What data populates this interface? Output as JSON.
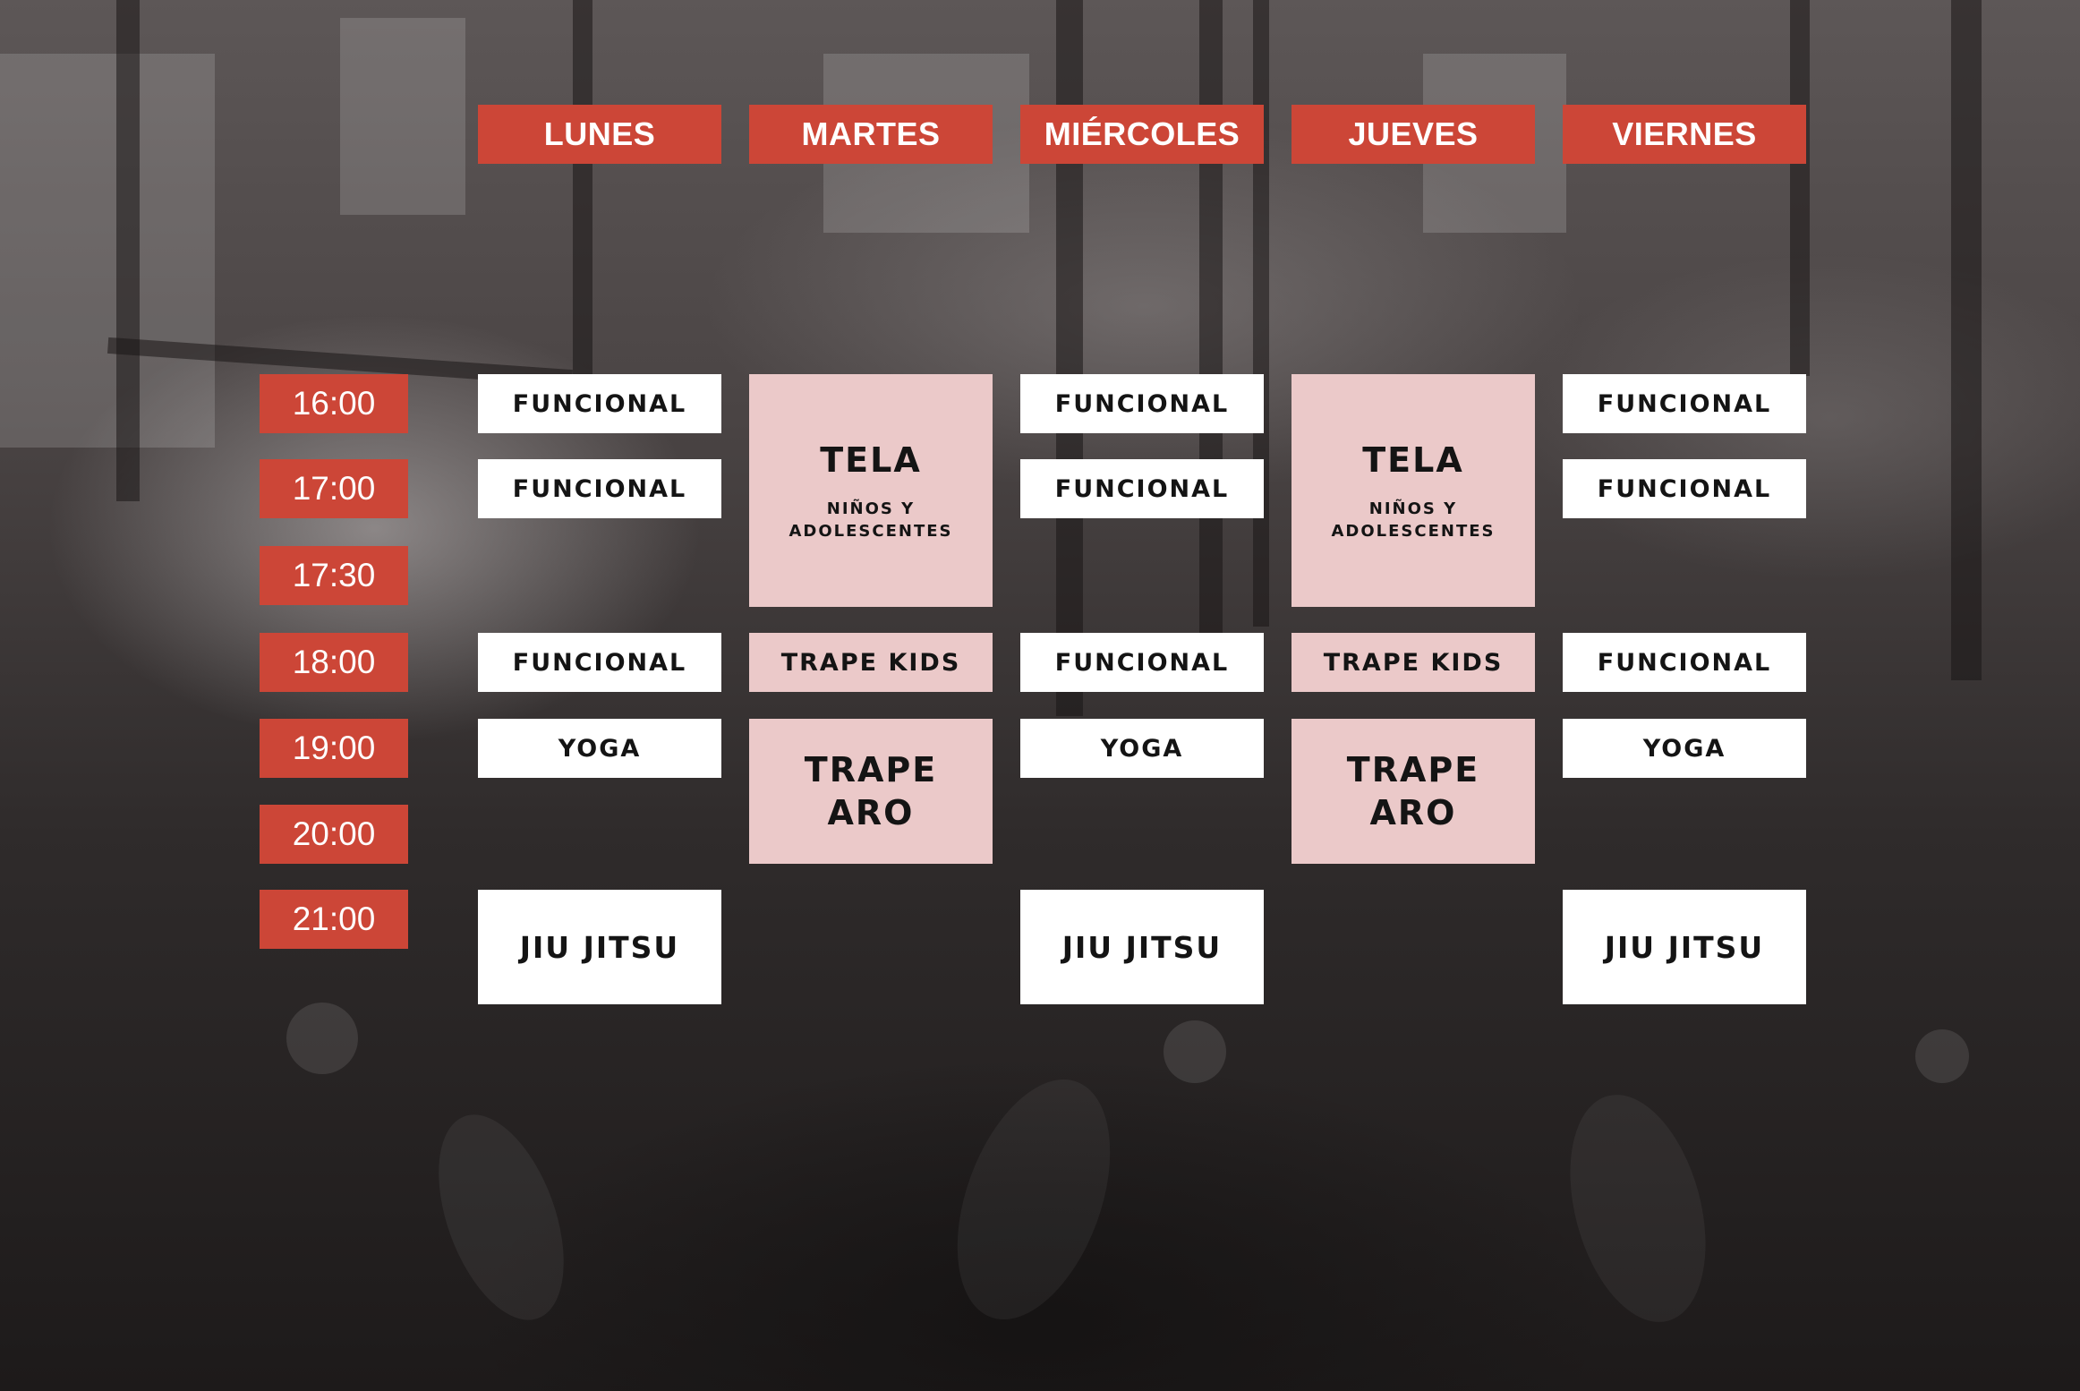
{
  "days": [
    "LUNES",
    "MARTES",
    "MIÉRCOLES",
    "JUEVES",
    "VIERNES"
  ],
  "times": [
    "16:00",
    "17:00",
    "17:30",
    "18:00",
    "19:00",
    "20:00",
    "21:00"
  ],
  "classes": {
    "funcional": "FUNCIONAL",
    "yoga": "YOGA",
    "jiu_jitsu": "JIU JITSU",
    "tela": "TELA",
    "tela_sub_line1": "NIÑOS Y",
    "tela_sub_line2": "ADOLESCENTES",
    "trape_kids": "TRAPE KIDS",
    "trape_aro_line1": "TRAPE",
    "trape_aro_line2": "ARO"
  },
  "colors": {
    "header_red": "#cc4637",
    "class_white": "#ffffff",
    "class_pink": "#ebc9c9"
  }
}
